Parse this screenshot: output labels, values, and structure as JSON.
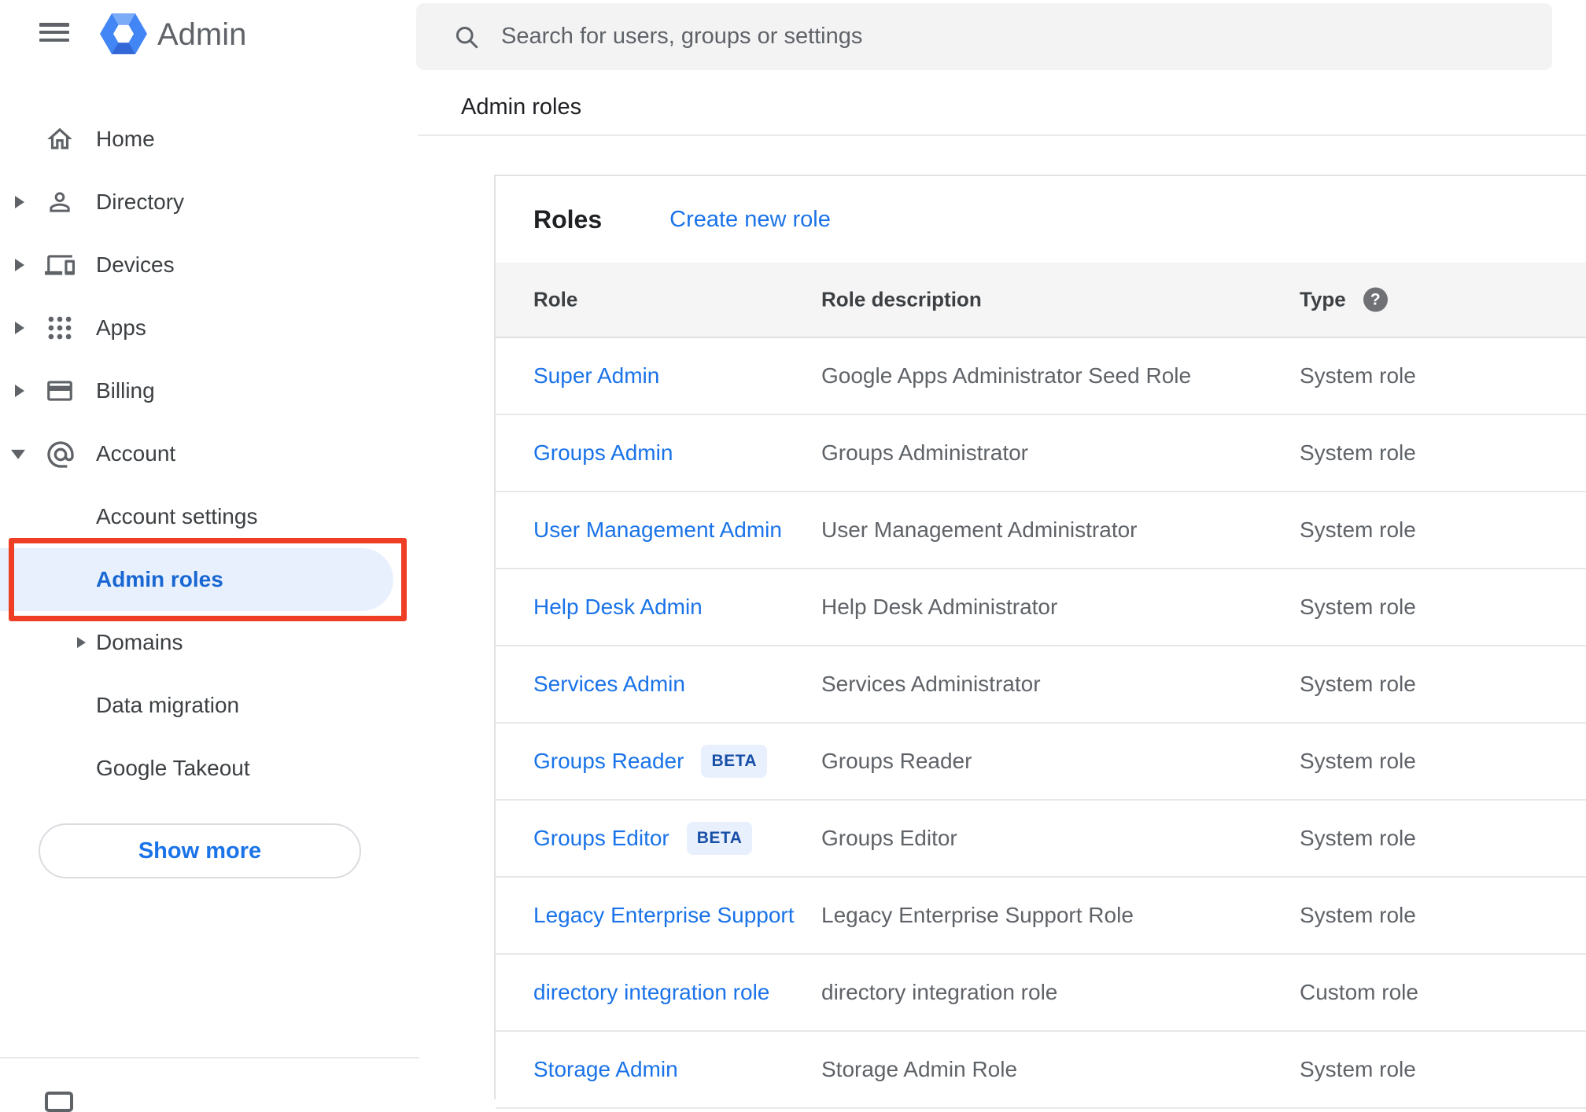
{
  "app": {
    "title": "Admin"
  },
  "search": {
    "placeholder": "Search for users, groups or settings"
  },
  "breadcrumb": {
    "label": "Admin roles"
  },
  "icons": {
    "help_glyph": "?"
  },
  "sidebar": {
    "items": [
      {
        "label": "Home"
      },
      {
        "label": "Directory"
      },
      {
        "label": "Devices"
      },
      {
        "label": "Apps"
      },
      {
        "label": "Billing"
      },
      {
        "label": "Account"
      }
    ],
    "account_children": [
      {
        "label": "Account settings"
      },
      {
        "label": "Admin roles",
        "active": true
      },
      {
        "label": "Domains"
      },
      {
        "label": "Data migration"
      },
      {
        "label": "Google Takeout"
      }
    ],
    "show_more_label": "Show more"
  },
  "main": {
    "card_title": "Roles",
    "create_new_role_label": "Create new role",
    "table": {
      "columns": {
        "role": "Role",
        "description": "Role description",
        "type": "Type"
      },
      "rows": [
        {
          "role": "Super Admin",
          "beta": "",
          "description": "Google Apps Administrator Seed Role",
          "type": "System role"
        },
        {
          "role": "Groups Admin",
          "beta": "",
          "description": "Groups Administrator",
          "type": "System role"
        },
        {
          "role": "User Management Admin",
          "beta": "",
          "description": "User Management Administrator",
          "type": "System role"
        },
        {
          "role": "Help Desk Admin",
          "beta": "",
          "description": "Help Desk Administrator",
          "type": "System role"
        },
        {
          "role": "Services Admin",
          "beta": "",
          "description": "Services Administrator",
          "type": "System role"
        },
        {
          "role": "Groups Reader",
          "beta": "BETA",
          "description": "Groups Reader",
          "type": "System role"
        },
        {
          "role": "Groups Editor",
          "beta": "BETA",
          "description": "Groups Editor",
          "type": "System role"
        },
        {
          "role": "Legacy Enterprise Support",
          "beta": "",
          "description": "Legacy Enterprise Support Role",
          "type": "System role"
        },
        {
          "role": "directory integration role",
          "beta": "",
          "description": "directory integration role",
          "type": "Custom role"
        },
        {
          "role": "Storage Admin",
          "beta": "",
          "description": "Storage Admin Role",
          "type": "System role"
        }
      ]
    }
  },
  "colors": {
    "accent_blue": "#1a73e8",
    "active_item_blue": "#1967d2",
    "annotation_red": "#ee3e23",
    "beta_badge_bg": "#e8f0fe",
    "beta_badge_text": "#174ea6",
    "header_row_bg": "#f5f5f6"
  }
}
